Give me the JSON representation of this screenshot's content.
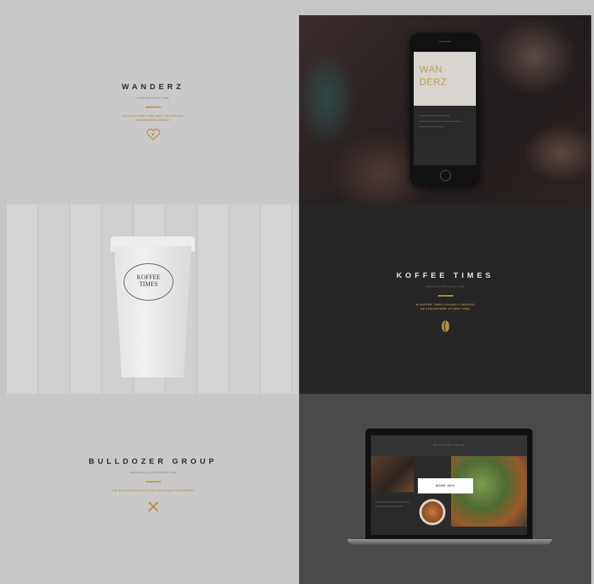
{
  "tiles": {
    "wanderz": {
      "name": "WANDERZ",
      "url": "WWW.WANDERZ.COM",
      "tagline": [
        "RUSSIA'S FIRST AND ONLY SKI-DRIVING",
        "ADVENTURES AGENCY"
      ],
      "icon": "heart-compass-icon"
    },
    "wanderz_phone": {
      "title_line1": "WAN",
      "title_line2": "DERZ"
    },
    "koffee_cup": {
      "seal_line1": "KOFFEE",
      "seal_line2": "TIMES"
    },
    "koffee_times": {
      "name": "KOFFEE TIMES",
      "url": "WWW.KOFFEETIMES.COM",
      "tagline": [
        "IN KOFFEE TIMES LOVINGLY CREATED",
        "AN ATMOSPHERE OF NEW YORK"
      ],
      "icon": "coffee-bean-icon"
    },
    "bulldozer": {
      "name": "BULLDOZER GROUP",
      "url": "WWW.BULLDOZERGROUP.COM",
      "tagline": [
        "THE BULLDOZER GROUP IS A BOUTIQUE INVESTMENT"
      ],
      "icon": "cross-tools-icon"
    },
    "bulldozer_laptop": {
      "header": "BULLDOZER GROUP",
      "more_info": "MORE INFO"
    }
  },
  "colors": {
    "accent": "#b8903a",
    "light_bg": "#c9c9c9",
    "dark_bg": "#262626"
  }
}
